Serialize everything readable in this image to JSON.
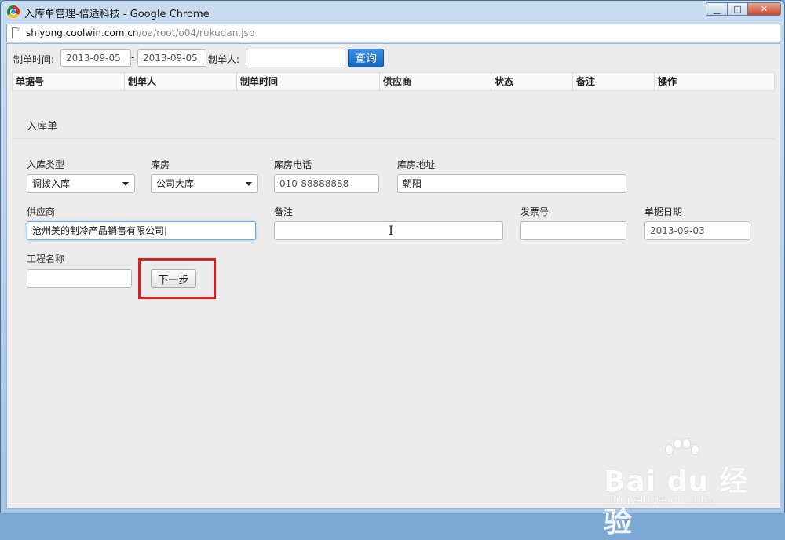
{
  "window": {
    "title": "入库单管理-倍适科技 - Google Chrome",
    "url_host": "shiyong.coolwin.com.cn",
    "url_path": "/oa/root/o04/rukudan.jsp",
    "controls": {
      "minimize": "▁",
      "maximize": "□",
      "close": "✕"
    }
  },
  "search": {
    "time_label": "制单时间:",
    "start_date": "2013-09-05",
    "separator": "-",
    "end_date": "2013-09-05",
    "creator_label": "制单人:",
    "creator_value": "",
    "query_button": "查询"
  },
  "table": {
    "columns": [
      "单据号",
      "制单人",
      "制单时间",
      "供应商",
      "状态",
      "备注",
      "操作"
    ]
  },
  "form": {
    "title": "入库单",
    "inbound_type": {
      "label": "入库类型",
      "value": "调拨入库"
    },
    "warehouse": {
      "label": "库房",
      "value": "公司大库"
    },
    "warehouse_phone": {
      "label": "库房电话",
      "value": "010-88888888"
    },
    "warehouse_address": {
      "label": "库房地址",
      "value": "朝阳"
    },
    "supplier": {
      "label": "供应商",
      "value": "沧州美的制冷产品销售有限公司"
    },
    "remark": {
      "label": "备注",
      "value": ""
    },
    "invoice_no": {
      "label": "发票号",
      "value": ""
    },
    "doc_date": {
      "label": "单据日期",
      "value": "2013-09-03"
    },
    "project_name": {
      "label": "工程名称",
      "value": ""
    },
    "next_button": "下一步"
  },
  "watermark": {
    "brand": "Bai du 经验",
    "site": "jingyan.baidu.com"
  },
  "colors": {
    "accent": "#1565c0",
    "highlight": "#e01b1b"
  }
}
